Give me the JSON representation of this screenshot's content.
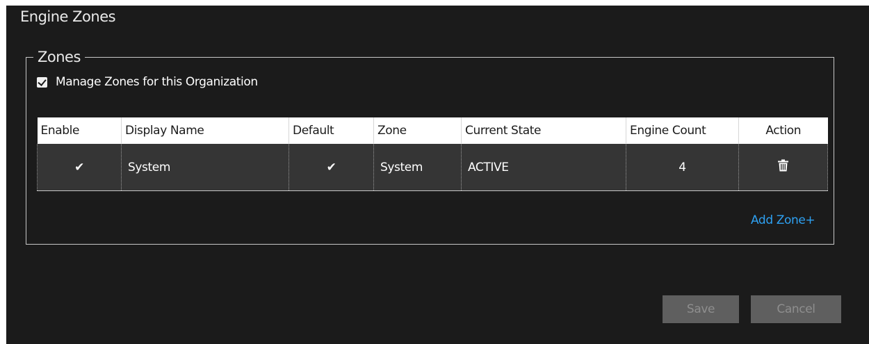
{
  "page": {
    "title": "Engine Zones"
  },
  "zones": {
    "legend": "Zones",
    "manage_label": "Manage Zones for this Organization",
    "manage_checked": true,
    "columns": [
      "Enable",
      "Display Name",
      "Default",
      "Zone",
      "Current State",
      "Engine Count",
      "Action"
    ],
    "rows": [
      {
        "enable": "✔",
        "display_name": "System",
        "default": "✔",
        "zone": "System",
        "current_state": "ACTIVE",
        "engine_count": "4",
        "action_icon": "trash-icon"
      }
    ],
    "add_zone_label": "Add Zone+"
  },
  "footer": {
    "save_label": "Save",
    "cancel_label": "Cancel"
  },
  "colors": {
    "background": "#1b1b1b",
    "row_background": "#353535",
    "link": "#2ea1f2",
    "button_disabled": "#5f5f5f"
  }
}
